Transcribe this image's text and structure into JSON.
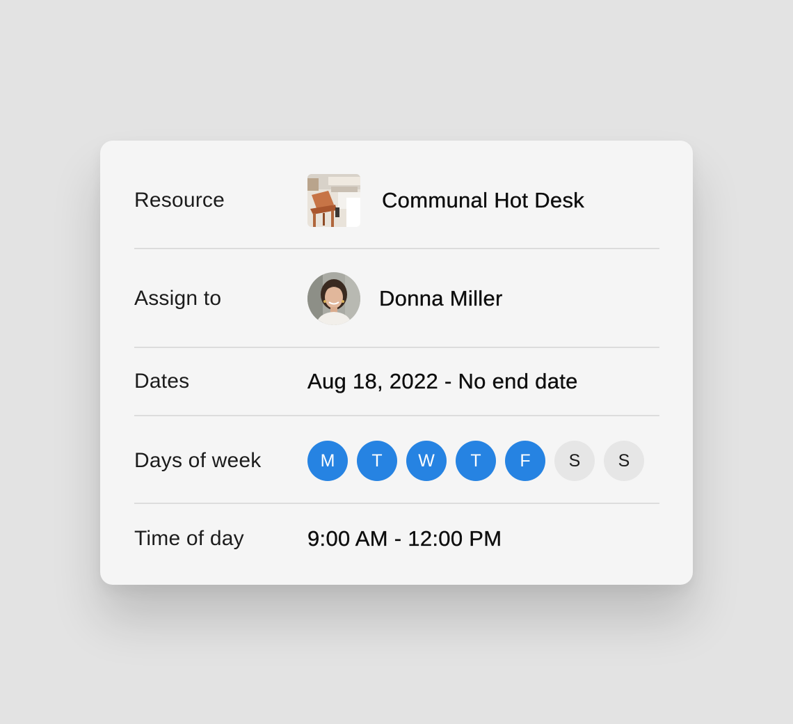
{
  "form": {
    "resource": {
      "label": "Resource",
      "value": "Communal Hot Desk",
      "image": "desk-chair-photo"
    },
    "assignee": {
      "label": "Assign to",
      "value": "Donna Miller",
      "image": "avatar-photo"
    },
    "dates": {
      "label": "Dates",
      "value": "Aug 18, 2022 - No end date"
    },
    "days_of_week": {
      "label": "Days of week",
      "days": [
        {
          "letter": "M",
          "selected": true
        },
        {
          "letter": "T",
          "selected": true
        },
        {
          "letter": "W",
          "selected": true
        },
        {
          "letter": "T",
          "selected": true
        },
        {
          "letter": "F",
          "selected": true
        },
        {
          "letter": "S",
          "selected": false
        },
        {
          "letter": "S",
          "selected": false
        }
      ]
    },
    "time_of_day": {
      "label": "Time of day",
      "value": "9:00 AM - 12:00 PM"
    }
  },
  "colors": {
    "selected_day": "#2683e2",
    "unselected_day": "#e6e6e6",
    "card_background": "#f5f5f5",
    "page_background": "#e3e3e3"
  }
}
